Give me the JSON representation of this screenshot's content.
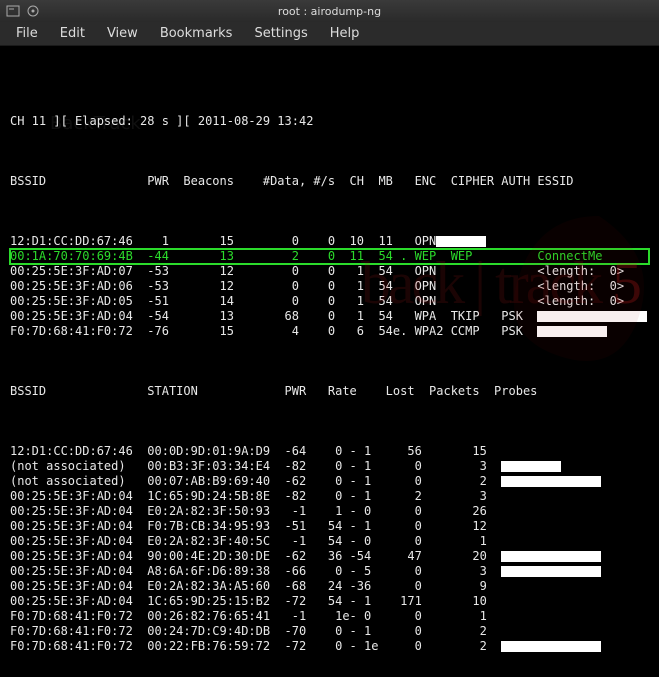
{
  "window": {
    "title": "root : airodump-ng"
  },
  "menu": {
    "items": [
      "File",
      "Edit",
      "View",
      "Bookmarks",
      "Settings",
      "Help"
    ]
  },
  "watermark": "BackTrack",
  "bt_label": "back | track",
  "bt_ver": "5",
  "header": {
    "channel_line": "CH 11 ][ Elapsed: 28 s ][ 2011-08-29 13:42",
    "cols1": "BSSID              PWR  Beacons    #Data, #/s  CH  MB   ENC  CIPHER AUTH ESSID",
    "cols2": "BSSID              STATION            PWR   Rate    Lost  Packets  Probes"
  },
  "ap_rows": [
    {
      "line": "12:D1:CC:DD:67:46    1       15        0    0  10  11   OPN",
      "essid_redact": 50
    },
    {
      "line": "00:1A:70:70:69:4B  -44       13        2    0  11  54 . WEP  WEP         ConnectMe",
      "highlight": true
    },
    {
      "line": "00:25:5E:3F:AD:07  -53       12        0    0   1  54   OPN              <length:  0>"
    },
    {
      "line": "00:25:5E:3F:AD:06  -53       12        0    0   1  54   OPN              <length:  0>"
    },
    {
      "line": "00:25:5E:3F:AD:05  -51       14        0    0   1  54   OPN              <length:  0>"
    },
    {
      "line": "00:25:5E:3F:AD:04  -54       13       68    0   1  54   WPA  TKIP   PSK  ",
      "essid_redact": 110
    },
    {
      "line": "F0:7D:68:41:F0:72  -76       15        4    0   6  54e. WPA2 CCMP   PSK  ",
      "essid_redact": 70
    }
  ],
  "sta_rows": [
    {
      "line": "12:D1:CC:DD:67:46  00:0D:9D:01:9A:D9  -64    0 - 1     56       15"
    },
    {
      "line": "(not associated)   00:B3:3F:03:34:E4  -82    0 - 1      0        3  ",
      "probe_redact": 60
    },
    {
      "line": "(not associated)   00:07:AB:B9:69:40  -62    0 - 1      0        2  ",
      "probe_redact": 100
    },
    {
      "line": "00:25:5E:3F:AD:04  1C:65:9D:24:5B:8E  -82    0 - 1      2        3"
    },
    {
      "line": "00:25:5E:3F:AD:04  E0:2A:82:3F:50:93   -1    1 - 0      0       26"
    },
    {
      "line": "00:25:5E:3F:AD:04  F0:7B:CB:34:95:93  -51   54 - 1      0       12"
    },
    {
      "line": "00:25:5E:3F:AD:04  E0:2A:82:3F:40:5C   -1   54 - 0      0        1"
    },
    {
      "line": "00:25:5E:3F:AD:04  90:00:4E:2D:30:DE  -62   36 -54     47       20  ",
      "probe_redact": 100
    },
    {
      "line": "00:25:5E:3F:AD:04  A8:6A:6F:D6:89:38  -66    0 - 5      0        3  ",
      "probe_redact": 100
    },
    {
      "line": "00:25:5E:3F:AD:04  E0:2A:82:3A:A5:60  -68   24 -36      0        9"
    },
    {
      "line": "00:25:5E:3F:AD:04  1C:65:9D:25:15:B2  -72   54 - 1    171       10"
    },
    {
      "line": "F0:7D:68:41:F0:72  00:26:82:76:65:41   -1    1e- 0      0        1"
    },
    {
      "line": "F0:7D:68:41:F0:72  00:24:7D:C9:4D:DB  -70    0 - 1      0        2"
    },
    {
      "line": "F0:7D:68:41:F0:72  00:22:FB:76:59:72  -72    0 - 1e     0        2  ",
      "probe_redact": 100
    }
  ]
}
